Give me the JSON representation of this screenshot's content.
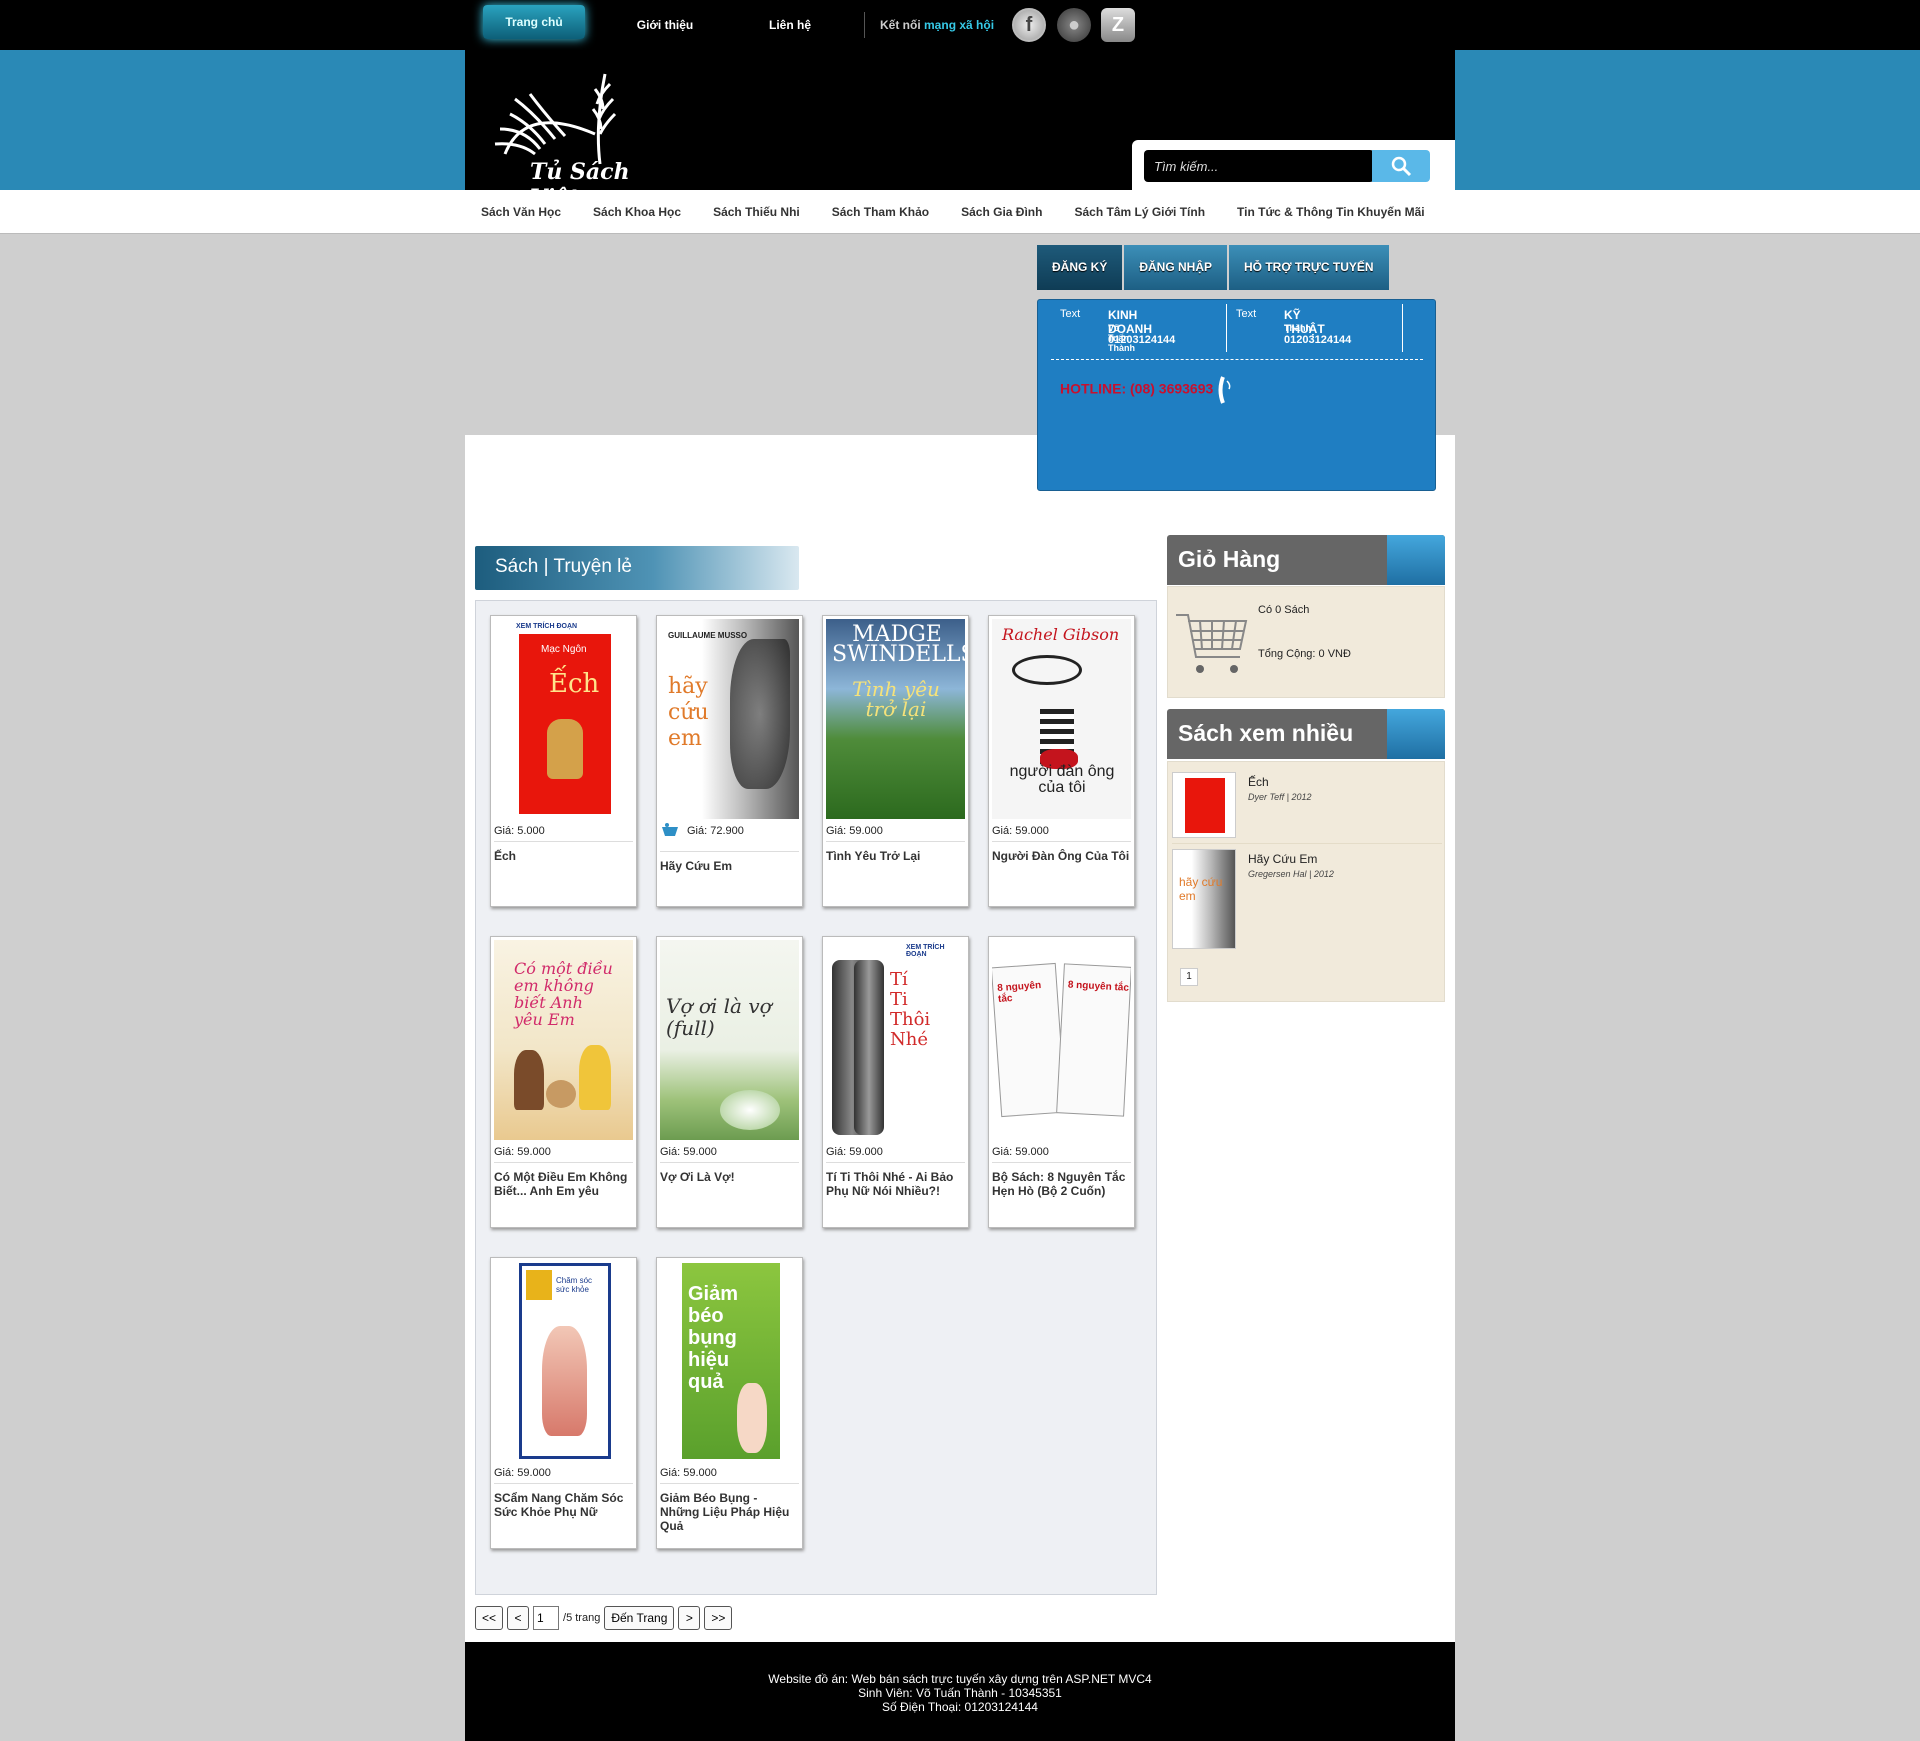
{
  "top_nav": {
    "home": "Trang chủ",
    "about": "Giới thiệu",
    "contact": "Liên hệ",
    "social_prefix": "Kết nối",
    "social_highlight": "mạng xã hội"
  },
  "brand": {
    "logo_text": "Tủ Sách Việt"
  },
  "search": {
    "placeholder": "Tìm kiếm..."
  },
  "categories": [
    "Sách Văn Học",
    "Sách Khoa Học",
    "Sách Thiếu Nhi",
    "Sách Tham Khảo",
    "Sách Gia Đình",
    "Sách Tâm Lý Giới Tính",
    "Tin Tức & Thông Tin Khuyến Mãi"
  ],
  "account_tabs": [
    "ĐĂNG KÝ",
    "ĐĂNG NHẬP",
    "HỖ TRỢ TRỰC TUYẾN"
  ],
  "support": {
    "img_alt": "Text",
    "business": {
      "title": "KINH DOANH",
      "name": "Võ Tuấn Thành",
      "phone": "01203124144"
    },
    "technical": {
      "title": "KỸ THUẬT",
      "name": "Thành",
      "phone": "01203124144"
    },
    "hotline": "HOTLINE: (08) 3693693"
  },
  "section_title": "Sách | Truyện lẻ",
  "books": [
    {
      "price": "Giá: 5.000",
      "title": "Ếch"
    },
    {
      "price": "Giá: 72.900",
      "title": "Hãy Cứu Em"
    },
    {
      "price": "Giá: 59.000",
      "title": "Tình Yêu Trở Lại"
    },
    {
      "price": "Giá: 59.000",
      "title": "Người Đàn Ông Của Tôi"
    },
    {
      "price": "Giá: 59.000",
      "title": "Có Một Điều Em Không Biết... Anh Em yêu"
    },
    {
      "price": "Giá: 59.000",
      "title": "Vợ Ơi Là Vợ!"
    },
    {
      "price": "Giá: 59.000",
      "title": "Tí Ti Thôi Nhé - Ai Bảo Phụ Nữ Nói Nhiều?!"
    },
    {
      "price": "Giá: 59.000",
      "title": "Bộ Sách: 8 Nguyên Tắc Hẹn Hò (Bộ 2 Cuốn)"
    },
    {
      "price": "Giá: 59.000",
      "title": "SCẩm Nang Chăm Sóc Sức Khỏe Phụ Nữ"
    },
    {
      "price": "Giá: 59.000",
      "title": "Giảm Béo Bụng - Những Liệu Pháp Hiệu Quả"
    }
  ],
  "cover_text": {
    "b1_top": "XEM TRÍCH ĐOẠN",
    "b1_author": "Mạc Ngôn",
    "b1_main": "Ếch",
    "b2_top": "GUILLAUME MUSSO",
    "b2_main": "hãy cứu em",
    "b3_top": "MADGE SWINDELLS",
    "b3_main": "Tình yêu trở lại",
    "b4_top": "Rachel Gibson",
    "b4_main": "người đàn ông của tôi",
    "b5_main": "Có một điều em không biết Anh yêu Em",
    "b6_main": "Vợ ơi là vợ (full)",
    "b7_top": "XEM TRÍCH ĐOẠN",
    "b7_main": "Tí Ti Thôi Nhé",
    "b8_main": "8 nguyên tắc",
    "b9_main": "Chăm sóc sức khỏe",
    "b10_main": "Giảm béo bụng hiệu quả"
  },
  "pager": {
    "first": "<<",
    "prev": "<",
    "page_value": "1",
    "total": "/5 trang",
    "go": "Đến Trang",
    "next": ">",
    "last": ">>"
  },
  "cart": {
    "title": "Giỏ Hàng",
    "count": "Có 0 Sách",
    "total": "Tổng Cộng: 0 VNĐ"
  },
  "popular": {
    "title": "Sách xem nhiều",
    "items": [
      {
        "title": "Ếch",
        "meta": "Dyer Teff | 2012"
      },
      {
        "title": "Hãy Cứu Em",
        "meta": "Gregersen Hal | 2012"
      }
    ],
    "page": "1"
  },
  "footer": {
    "line1": "Website đồ án: Web bán sách trực tuyến xây dựng trên ASP.NET MVC4",
    "line2": "Sinh Viên: Võ Tuấn Thành - 10345351",
    "line3": "Số Điện Thoại: 01203124144"
  }
}
